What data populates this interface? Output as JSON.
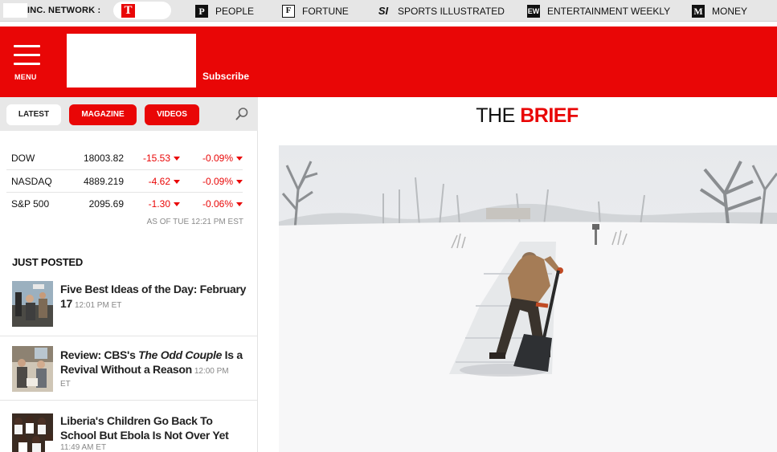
{
  "network": {
    "label": "INC. NETWORK :",
    "t_mark": "T",
    "items": [
      {
        "mark": "P",
        "label": "PEOPLE",
        "icon": "people-logo-icon"
      },
      {
        "mark": "F",
        "label": "FORTUNE",
        "icon": "fortune-logo-icon"
      },
      {
        "mark": "SI",
        "label": "SPORTS ILLUSTRATED",
        "icon": "si-logo-icon"
      },
      {
        "mark": "EW",
        "label": "ENTERTAINMENT WEEKLY",
        "icon": "ew-logo-icon"
      },
      {
        "mark": "M",
        "label": "MONEY",
        "icon": "money-logo-icon"
      }
    ]
  },
  "header": {
    "menu_label": "MENU",
    "subscribe_label": "Subscribe",
    "brand_color": "#e90606"
  },
  "tabs": {
    "latest": "LATEST",
    "magazine": "MAGAZINE",
    "videos": "VIDEOS"
  },
  "stocks": {
    "rows": [
      {
        "name": "DOW",
        "value": "18003.82",
        "change": "-15.53",
        "percent": "-0.09%"
      },
      {
        "name": "NASDAQ",
        "value": "4889.219",
        "change": "-4.62",
        "percent": "-0.09%"
      },
      {
        "name": "S&P 500",
        "value": "2095.69",
        "change": "-1.30",
        "percent": "-0.06%"
      }
    ],
    "as_of": "AS OF TUE 12:21 PM EST"
  },
  "just_posted": {
    "heading": "JUST POSTED",
    "posts": [
      {
        "title_a": "Five Best Ideas of the Day: February 17",
        "title_italic": "",
        "title_b": "",
        "time": "12:01 PM ET"
      },
      {
        "title_a": "Review: CBS's ",
        "title_italic": "The Odd Couple",
        "title_b": " Is a Revival Without a Reason",
        "time_a": "12:00 PM",
        "time_b": "ET"
      },
      {
        "title_a": "Liberia's Children Go Back To School But Ebola Is Not Over Yet",
        "title_italic": "",
        "title_b": "",
        "time": "11:49 AM ET"
      }
    ]
  },
  "brief": {
    "title_prefix": "THE ",
    "title_highlight": "BRIEF"
  }
}
